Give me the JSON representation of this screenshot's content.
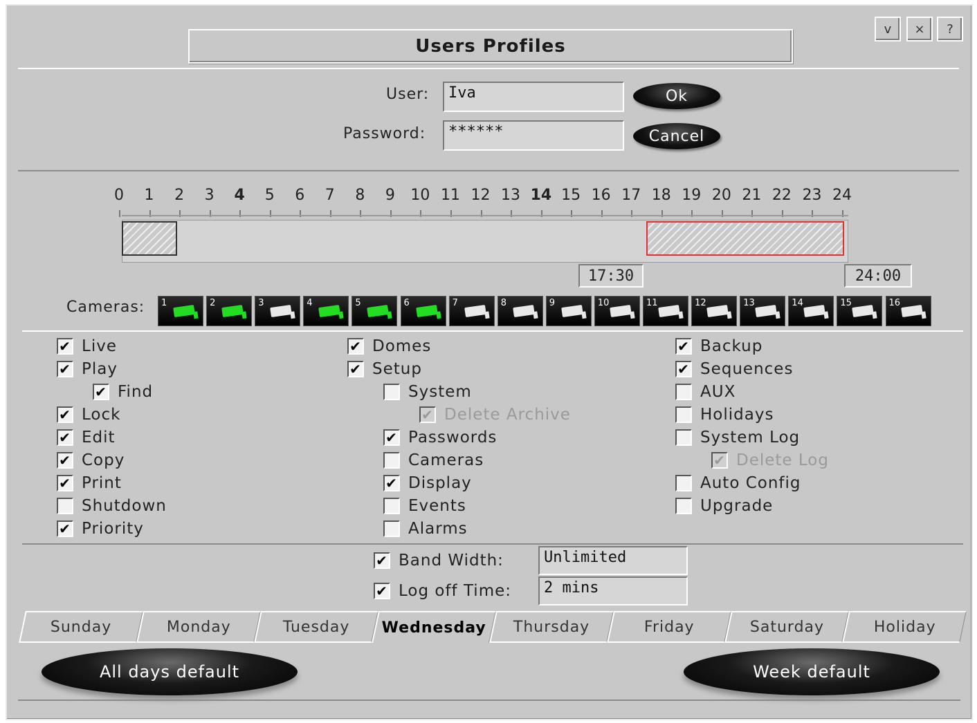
{
  "window": {
    "title": "Users Profiles",
    "btn_minimize": "v",
    "btn_close": "×",
    "btn_help": "?"
  },
  "login": {
    "user_label": "User:",
    "user_value": "Iva",
    "password_label": "Password:",
    "password_value": "******",
    "ok_label": "Ok",
    "cancel_label": "Cancel"
  },
  "timeline": {
    "hours": [
      "0",
      "1",
      "2",
      "3",
      "4",
      "5",
      "6",
      "7",
      "8",
      "9",
      "10",
      "11",
      "12",
      "13",
      "14",
      "15",
      "16",
      "17",
      "18",
      "19",
      "20",
      "21",
      "22",
      "23",
      "24"
    ],
    "bold_hours": [
      "4",
      "14"
    ],
    "start_time": "17:30",
    "end_time": "24:00"
  },
  "cameras": {
    "label": "Cameras:",
    "items": [
      {
        "num": "1",
        "state": "on"
      },
      {
        "num": "2",
        "state": "on"
      },
      {
        "num": "3",
        "state": "off"
      },
      {
        "num": "4",
        "state": "on"
      },
      {
        "num": "5",
        "state": "on"
      },
      {
        "num": "6",
        "state": "on"
      },
      {
        "num": "7",
        "state": "off"
      },
      {
        "num": "8",
        "state": "off"
      },
      {
        "num": "9",
        "state": "off"
      },
      {
        "num": "10",
        "state": "off"
      },
      {
        "num": "11",
        "state": "off"
      },
      {
        "num": "12",
        "state": "off"
      },
      {
        "num": "13",
        "state": "off"
      },
      {
        "num": "14",
        "state": "off"
      },
      {
        "num": "15",
        "state": "off"
      },
      {
        "num": "16",
        "state": "off"
      }
    ]
  },
  "permissions": {
    "col1": [
      {
        "label": "Live",
        "checked": true,
        "indent": 0,
        "disabled": false
      },
      {
        "label": "Play",
        "checked": true,
        "indent": 0,
        "disabled": false
      },
      {
        "label": "Find",
        "checked": true,
        "indent": 1,
        "disabled": false
      },
      {
        "label": "Lock",
        "checked": true,
        "indent": 0,
        "disabled": false
      },
      {
        "label": "Edit",
        "checked": true,
        "indent": 0,
        "disabled": false
      },
      {
        "label": "Copy",
        "checked": true,
        "indent": 0,
        "disabled": false
      },
      {
        "label": "Print",
        "checked": true,
        "indent": 0,
        "disabled": false
      },
      {
        "label": "Shutdown",
        "checked": false,
        "indent": 0,
        "disabled": false
      },
      {
        "label": "Priority",
        "checked": true,
        "indent": 0,
        "disabled": false
      }
    ],
    "col2": [
      {
        "label": "Domes",
        "checked": true,
        "indent": 0,
        "disabled": false
      },
      {
        "label": "Setup",
        "checked": true,
        "indent": 0,
        "disabled": false
      },
      {
        "label": "System",
        "checked": false,
        "indent": 1,
        "disabled": false
      },
      {
        "label": "Delete Archive",
        "checked": true,
        "indent": 2,
        "disabled": true
      },
      {
        "label": "Passwords",
        "checked": true,
        "indent": 1,
        "disabled": false
      },
      {
        "label": "Cameras",
        "checked": false,
        "indent": 1,
        "disabled": false
      },
      {
        "label": "Display",
        "checked": true,
        "indent": 1,
        "disabled": false
      },
      {
        "label": "Events",
        "checked": false,
        "indent": 1,
        "disabled": false
      },
      {
        "label": "Alarms",
        "checked": false,
        "indent": 1,
        "disabled": false
      }
    ],
    "col3": [
      {
        "label": "Backup",
        "checked": true,
        "indent": 0,
        "disabled": false
      },
      {
        "label": "Sequences",
        "checked": true,
        "indent": 0,
        "disabled": false
      },
      {
        "label": "AUX",
        "checked": false,
        "indent": 0,
        "disabled": false
      },
      {
        "label": "Holidays",
        "checked": false,
        "indent": 0,
        "disabled": false
      },
      {
        "label": "System Log",
        "checked": false,
        "indent": 0,
        "disabled": false
      },
      {
        "label": "Delete Log",
        "checked": true,
        "indent": 1,
        "disabled": true
      },
      {
        "label": "Auto Config",
        "checked": false,
        "indent": 0,
        "disabled": false
      },
      {
        "label": "Upgrade",
        "checked": false,
        "indent": 0,
        "disabled": false
      }
    ]
  },
  "limits": {
    "bandwidth_label": "Band Width:",
    "bandwidth_checked": true,
    "bandwidth_value": "Unlimited",
    "logoff_label": "Log off Time:",
    "logoff_checked": true,
    "logoff_value": "2 mins"
  },
  "tabs": {
    "items": [
      "Sunday",
      "Monday",
      "Tuesday",
      "Wednesday",
      "Thursday",
      "Friday",
      "Saturday",
      "Holiday"
    ],
    "active": "Wednesday"
  },
  "footer": {
    "all_days_default": "All days default",
    "week_default": "Week default"
  },
  "colors": {
    "camera_on": "#22dd22",
    "schedule_selected_border": "#e03030",
    "window_bg": "#c8c8c8"
  }
}
